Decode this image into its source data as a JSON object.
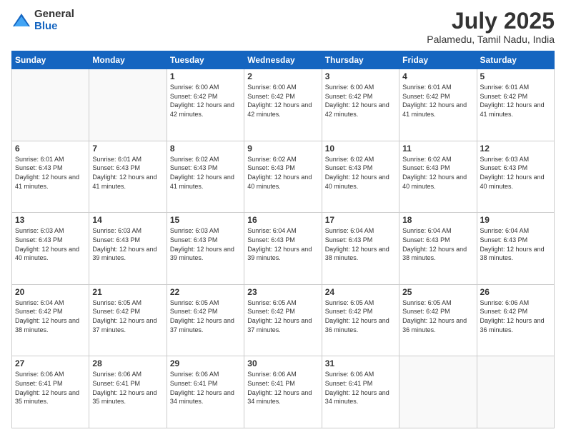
{
  "logo": {
    "general": "General",
    "blue": "Blue"
  },
  "title": {
    "month": "July 2025",
    "location": "Palamedu, Tamil Nadu, India"
  },
  "headers": [
    "Sunday",
    "Monday",
    "Tuesday",
    "Wednesday",
    "Thursday",
    "Friday",
    "Saturday"
  ],
  "weeks": [
    [
      {
        "num": "",
        "info": ""
      },
      {
        "num": "",
        "info": ""
      },
      {
        "num": "1",
        "info": "Sunrise: 6:00 AM\nSunset: 6:42 PM\nDaylight: 12 hours and 42 minutes."
      },
      {
        "num": "2",
        "info": "Sunrise: 6:00 AM\nSunset: 6:42 PM\nDaylight: 12 hours and 42 minutes."
      },
      {
        "num": "3",
        "info": "Sunrise: 6:00 AM\nSunset: 6:42 PM\nDaylight: 12 hours and 42 minutes."
      },
      {
        "num": "4",
        "info": "Sunrise: 6:01 AM\nSunset: 6:42 PM\nDaylight: 12 hours and 41 minutes."
      },
      {
        "num": "5",
        "info": "Sunrise: 6:01 AM\nSunset: 6:42 PM\nDaylight: 12 hours and 41 minutes."
      }
    ],
    [
      {
        "num": "6",
        "info": "Sunrise: 6:01 AM\nSunset: 6:43 PM\nDaylight: 12 hours and 41 minutes."
      },
      {
        "num": "7",
        "info": "Sunrise: 6:01 AM\nSunset: 6:43 PM\nDaylight: 12 hours and 41 minutes."
      },
      {
        "num": "8",
        "info": "Sunrise: 6:02 AM\nSunset: 6:43 PM\nDaylight: 12 hours and 41 minutes."
      },
      {
        "num": "9",
        "info": "Sunrise: 6:02 AM\nSunset: 6:43 PM\nDaylight: 12 hours and 40 minutes."
      },
      {
        "num": "10",
        "info": "Sunrise: 6:02 AM\nSunset: 6:43 PM\nDaylight: 12 hours and 40 minutes."
      },
      {
        "num": "11",
        "info": "Sunrise: 6:02 AM\nSunset: 6:43 PM\nDaylight: 12 hours and 40 minutes."
      },
      {
        "num": "12",
        "info": "Sunrise: 6:03 AM\nSunset: 6:43 PM\nDaylight: 12 hours and 40 minutes."
      }
    ],
    [
      {
        "num": "13",
        "info": "Sunrise: 6:03 AM\nSunset: 6:43 PM\nDaylight: 12 hours and 40 minutes."
      },
      {
        "num": "14",
        "info": "Sunrise: 6:03 AM\nSunset: 6:43 PM\nDaylight: 12 hours and 39 minutes."
      },
      {
        "num": "15",
        "info": "Sunrise: 6:03 AM\nSunset: 6:43 PM\nDaylight: 12 hours and 39 minutes."
      },
      {
        "num": "16",
        "info": "Sunrise: 6:04 AM\nSunset: 6:43 PM\nDaylight: 12 hours and 39 minutes."
      },
      {
        "num": "17",
        "info": "Sunrise: 6:04 AM\nSunset: 6:43 PM\nDaylight: 12 hours and 38 minutes."
      },
      {
        "num": "18",
        "info": "Sunrise: 6:04 AM\nSunset: 6:43 PM\nDaylight: 12 hours and 38 minutes."
      },
      {
        "num": "19",
        "info": "Sunrise: 6:04 AM\nSunset: 6:43 PM\nDaylight: 12 hours and 38 minutes."
      }
    ],
    [
      {
        "num": "20",
        "info": "Sunrise: 6:04 AM\nSunset: 6:42 PM\nDaylight: 12 hours and 38 minutes."
      },
      {
        "num": "21",
        "info": "Sunrise: 6:05 AM\nSunset: 6:42 PM\nDaylight: 12 hours and 37 minutes."
      },
      {
        "num": "22",
        "info": "Sunrise: 6:05 AM\nSunset: 6:42 PM\nDaylight: 12 hours and 37 minutes."
      },
      {
        "num": "23",
        "info": "Sunrise: 6:05 AM\nSunset: 6:42 PM\nDaylight: 12 hours and 37 minutes."
      },
      {
        "num": "24",
        "info": "Sunrise: 6:05 AM\nSunset: 6:42 PM\nDaylight: 12 hours and 36 minutes."
      },
      {
        "num": "25",
        "info": "Sunrise: 6:05 AM\nSunset: 6:42 PM\nDaylight: 12 hours and 36 minutes."
      },
      {
        "num": "26",
        "info": "Sunrise: 6:06 AM\nSunset: 6:42 PM\nDaylight: 12 hours and 36 minutes."
      }
    ],
    [
      {
        "num": "27",
        "info": "Sunrise: 6:06 AM\nSunset: 6:41 PM\nDaylight: 12 hours and 35 minutes."
      },
      {
        "num": "28",
        "info": "Sunrise: 6:06 AM\nSunset: 6:41 PM\nDaylight: 12 hours and 35 minutes."
      },
      {
        "num": "29",
        "info": "Sunrise: 6:06 AM\nSunset: 6:41 PM\nDaylight: 12 hours and 34 minutes."
      },
      {
        "num": "30",
        "info": "Sunrise: 6:06 AM\nSunset: 6:41 PM\nDaylight: 12 hours and 34 minutes."
      },
      {
        "num": "31",
        "info": "Sunrise: 6:06 AM\nSunset: 6:41 PM\nDaylight: 12 hours and 34 minutes."
      },
      {
        "num": "",
        "info": ""
      },
      {
        "num": "",
        "info": ""
      }
    ]
  ]
}
